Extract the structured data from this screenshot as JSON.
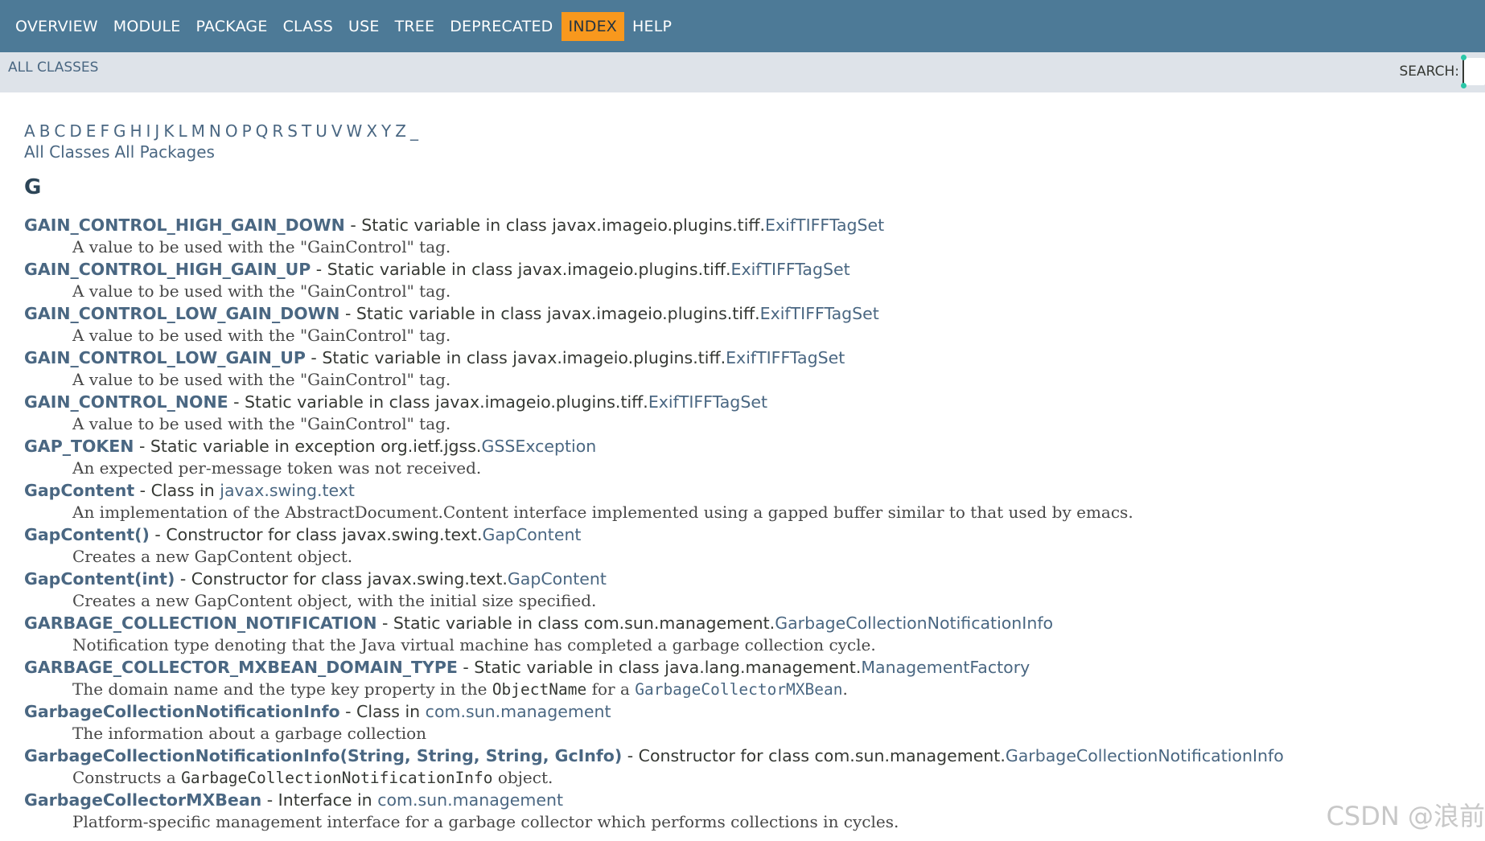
{
  "nav": {
    "items": [
      {
        "label": "OVERVIEW",
        "active": false
      },
      {
        "label": "MODULE",
        "active": false
      },
      {
        "label": "PACKAGE",
        "active": false
      },
      {
        "label": "CLASS",
        "active": false
      },
      {
        "label": "USE",
        "active": false
      },
      {
        "label": "TREE",
        "active": false
      },
      {
        "label": "DEPRECATED",
        "active": false
      },
      {
        "label": "INDEX",
        "active": true
      },
      {
        "label": "HELP",
        "active": false
      }
    ]
  },
  "subnav": {
    "all_classes": "ALL CLASSES",
    "search_label": "SEARCH:"
  },
  "letters": [
    "A",
    "B",
    "C",
    "D",
    "E",
    "F",
    "G",
    "H",
    "I",
    "J",
    "K",
    "L",
    "M",
    "N",
    "O",
    "P",
    "Q",
    "R",
    "S",
    "T",
    "U",
    "V",
    "W",
    "X",
    "Y",
    "Z",
    "_"
  ],
  "all_links": [
    "All Classes",
    "All Packages"
  ],
  "section_letter": "G",
  "entries": [
    {
      "name": "GAIN_CONTROL_HIGH_GAIN_DOWN",
      "rest": " - Static variable in class javax.imageio.plugins.tiff.",
      "link": "ExifTIFFTagSet",
      "desc": "A value to be used with the \"GainControl\" tag."
    },
    {
      "name": "GAIN_CONTROL_HIGH_GAIN_UP",
      "rest": " - Static variable in class javax.imageio.plugins.tiff.",
      "link": "ExifTIFFTagSet",
      "desc": "A value to be used with the \"GainControl\" tag."
    },
    {
      "name": "GAIN_CONTROL_LOW_GAIN_DOWN",
      "rest": " - Static variable in class javax.imageio.plugins.tiff.",
      "link": "ExifTIFFTagSet",
      "desc": "A value to be used with the \"GainControl\" tag."
    },
    {
      "name": "GAIN_CONTROL_LOW_GAIN_UP",
      "rest": " - Static variable in class javax.imageio.plugins.tiff.",
      "link": "ExifTIFFTagSet",
      "desc": "A value to be used with the \"GainControl\" tag."
    },
    {
      "name": "GAIN_CONTROL_NONE",
      "rest": " - Static variable in class javax.imageio.plugins.tiff.",
      "link": "ExifTIFFTagSet",
      "desc": "A value to be used with the \"GainControl\" tag."
    },
    {
      "name": "GAP_TOKEN",
      "rest": " - Static variable in exception org.ietf.jgss.",
      "link": "GSSException",
      "desc": "An expected per-message token was not received."
    },
    {
      "name": "GapContent",
      "rest": " - Class in ",
      "link": "javax.swing.text",
      "desc": "An implementation of the AbstractDocument.Content interface implemented using a gapped buffer similar to that used by emacs."
    },
    {
      "name": "GapContent()",
      "rest": " - Constructor for class javax.swing.text.",
      "link": "GapContent",
      "desc": "Creates a new GapContent object."
    },
    {
      "name": "GapContent(int)",
      "rest": " - Constructor for class javax.swing.text.",
      "link": "GapContent",
      "desc": "Creates a new GapContent object, with the initial size specified."
    },
    {
      "name": "GARBAGE_COLLECTION_NOTIFICATION",
      "rest": " - Static variable in class com.sun.management.",
      "link": "GarbageCollectionNotificationInfo",
      "desc": "Notification type denoting that the Java virtual machine has completed a garbage collection cycle."
    },
    {
      "name": "GARBAGE_COLLECTOR_MXBEAN_DOMAIN_TYPE",
      "rest": " - Static variable in class java.lang.management.",
      "link": "ManagementFactory",
      "desc_parts": [
        "The domain name and the type key property in the ",
        "ObjectName",
        " for a ",
        "GarbageCollectorMXBean",
        "."
      ]
    },
    {
      "name": "GarbageCollectionNotificationInfo",
      "rest": " - Class in ",
      "link": "com.sun.management",
      "desc": "The information about a garbage collection"
    },
    {
      "name": "GarbageCollectionNotificationInfo(String, String, String, GcInfo)",
      "rest": " - Constructor for class com.sun.management.",
      "link": "GarbageCollectionNotificationInfo",
      "desc_parts": [
        "Constructs a ",
        "GarbageCollectionNotificationInfo",
        " object."
      ]
    },
    {
      "name": "GarbageCollectorMXBean",
      "rest": " - Interface in ",
      "link": "com.sun.management",
      "desc": "Platform-specific management interface for a garbage collector which performs collections in cycles."
    }
  ],
  "watermark": "CSDN @浪前"
}
